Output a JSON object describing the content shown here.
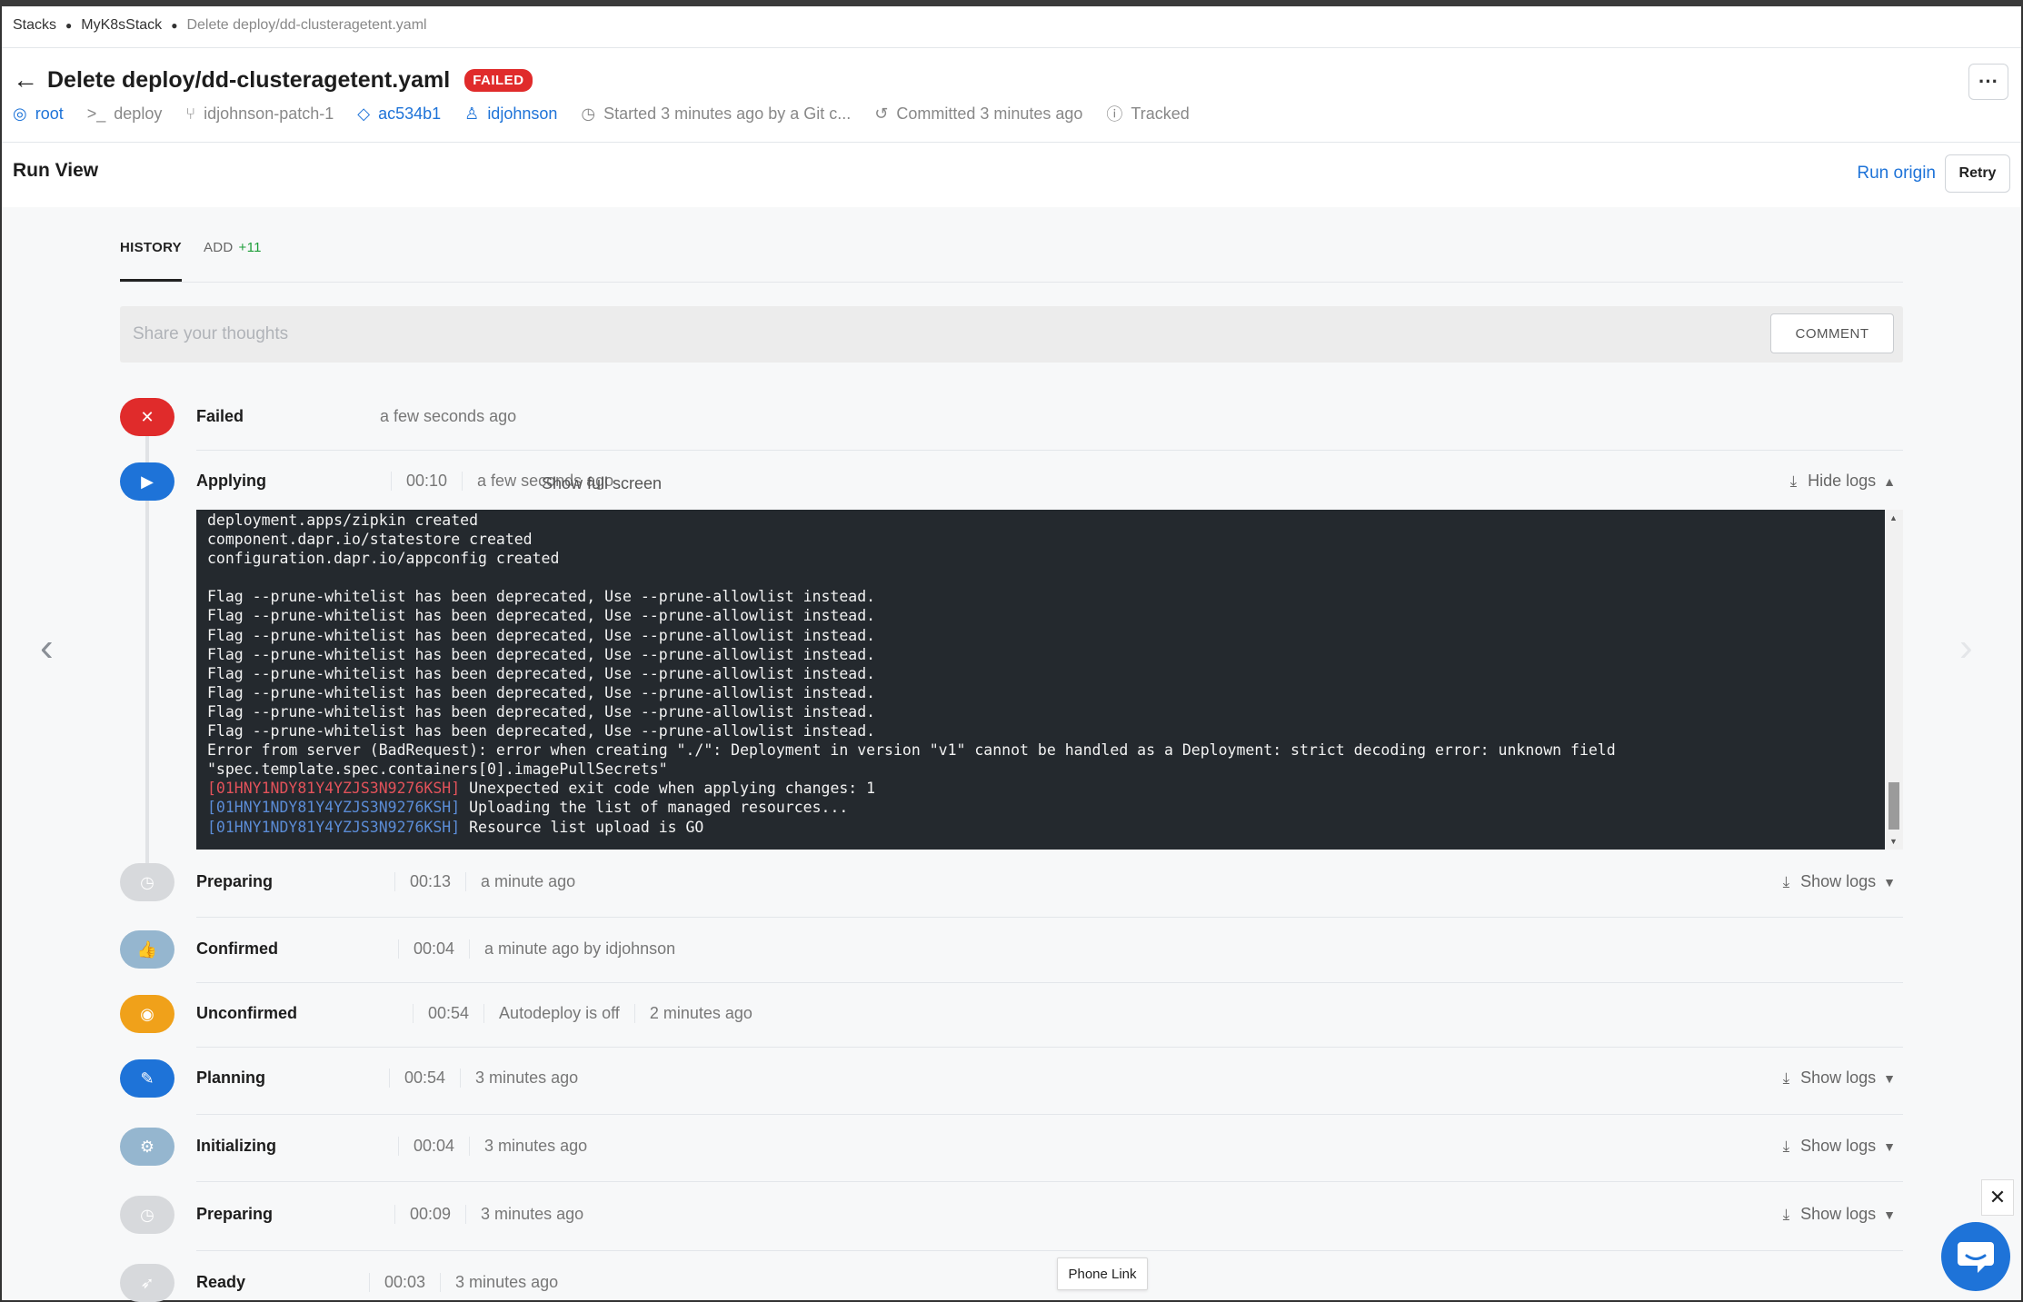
{
  "breadcrumb": [
    "Stacks",
    "MyK8sStack",
    "Delete deploy/dd-clusteragetent.yaml"
  ],
  "header": {
    "title": "Delete deploy/dd-clusteragetent.yaml",
    "status": "FAILED",
    "status_color": "#e02b2b",
    "more_label": "···"
  },
  "meta": {
    "space": "root",
    "project_root": "deploy",
    "branch": "idjohnson-patch-1",
    "commit": "ac534b1",
    "user": "idjohnson",
    "started": "Started 3 minutes ago by a Git c...",
    "committed": "Committed 3 minutes ago",
    "tracked": "Tracked"
  },
  "run_view": {
    "title": "Run View",
    "run_origin": "Run origin",
    "retry": "Retry"
  },
  "tabs": {
    "history": "HISTORY",
    "add": "ADD",
    "add_count": "+11"
  },
  "comment": {
    "placeholder": "Share your thoughts",
    "button": "COMMENT"
  },
  "steps": {
    "failed": {
      "label": "Failed",
      "time": "a few seconds ago"
    },
    "applying": {
      "label": "Applying",
      "duration": "00:10",
      "time": "a few seconds ago",
      "full_screen": "Show full screen",
      "logs": "Hide logs"
    },
    "preparing1": {
      "label": "Preparing",
      "duration": "00:13",
      "time": "a minute ago",
      "logs": "Show logs"
    },
    "confirmed": {
      "label": "Confirmed",
      "duration": "00:04",
      "time": "a minute ago by idjohnson"
    },
    "unconfirmed": {
      "label": "Unconfirmed",
      "duration": "00:54",
      "note": "Autodeploy is off",
      "time": "2 minutes ago"
    },
    "planning": {
      "label": "Planning",
      "duration": "00:54",
      "time": "3 minutes ago",
      "logs": "Show logs"
    },
    "initializing": {
      "label": "Initializing",
      "duration": "00:04",
      "time": "3 minutes ago",
      "logs": "Show logs"
    },
    "preparing2": {
      "label": "Preparing",
      "duration": "00:09",
      "time": "3 minutes ago",
      "logs": "Show logs"
    },
    "ready": {
      "label": "Ready",
      "duration": "00:03",
      "time": "3 minutes ago"
    }
  },
  "log_lines": [
    "deployment.apps/zipkin created",
    "component.dapr.io/statestore created",
    "configuration.dapr.io/appconfig created",
    "",
    "Flag --prune-whitelist has been deprecated, Use --prune-allowlist instead.",
    "Flag --prune-whitelist has been deprecated, Use --prune-allowlist instead.",
    "Flag --prune-whitelist has been deprecated, Use --prune-allowlist instead.",
    "Flag --prune-whitelist has been deprecated, Use --prune-allowlist instead.",
    "Flag --prune-whitelist has been deprecated, Use --prune-allowlist instead.",
    "Flag --prune-whitelist has been deprecated, Use --prune-allowlist instead.",
    "Flag --prune-whitelist has been deprecated, Use --prune-allowlist instead.",
    "Flag --prune-whitelist has been deprecated, Use --prune-allowlist instead.",
    "Error from server (BadRequest): error when creating \"./\": Deployment in version \"v1\" cannot be handled as a Deployment: strict decoding error: unknown field",
    "\"spec.template.spec.containers[0].imagePullSecrets\""
  ],
  "log_tagged": [
    {
      "tag": "[01HNY1NDY81Y4YZJS3N9276KSH]",
      "text": " Unexpected exit code when applying changes: 1",
      "color": "#e2525a"
    },
    {
      "tag": "[01HNY1NDY81Y4YZJS3N9276KSH]",
      "text": " Uploading the list of managed resources...",
      "color": "#5b8cd6"
    },
    {
      "tag": "[01HNY1NDY81Y4YZJS3N9276KSH]",
      "text": " Resource list upload is GO",
      "color": "#5b8cd6"
    }
  ],
  "overlay": {
    "phone_link": "Phone Link",
    "close": "✕"
  },
  "icons": {
    "back": "arrow-left-icon",
    "space": "space-icon",
    "terminal": "terminal-icon",
    "branch": "branch-icon",
    "commit": "commit-icon",
    "user": "user-icon",
    "clock": "clock-icon",
    "history": "history-icon",
    "info": "info-icon",
    "download": "download-icon",
    "chat": "chat-icon"
  }
}
